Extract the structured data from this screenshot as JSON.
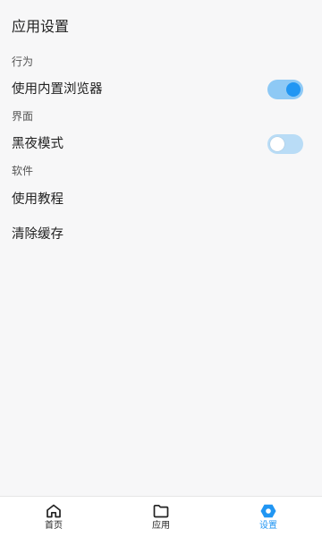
{
  "page": {
    "title": "应用设置"
  },
  "sections": [
    {
      "header": "行为",
      "items": [
        {
          "label": "使用内置浏览器",
          "toggle": "on"
        }
      ]
    },
    {
      "header": "界面",
      "items": [
        {
          "label": "黑夜模式",
          "toggle": "off"
        }
      ]
    },
    {
      "header": "软件",
      "items": [
        {
          "label": "使用教程"
        },
        {
          "label": "清除缓存"
        }
      ]
    }
  ],
  "bottom_nav": {
    "items": [
      {
        "label": "首页",
        "icon": "home-icon",
        "active": false
      },
      {
        "label": "应用",
        "icon": "folder-icon",
        "active": false
      },
      {
        "label": "设置",
        "icon": "settings-icon",
        "active": true
      }
    ]
  },
  "colors": {
    "accent": "#2196f3",
    "toggle_on_track": "#8ec9f5",
    "toggle_off_track": "#b9dcf6",
    "background": "#f7f7f8"
  }
}
